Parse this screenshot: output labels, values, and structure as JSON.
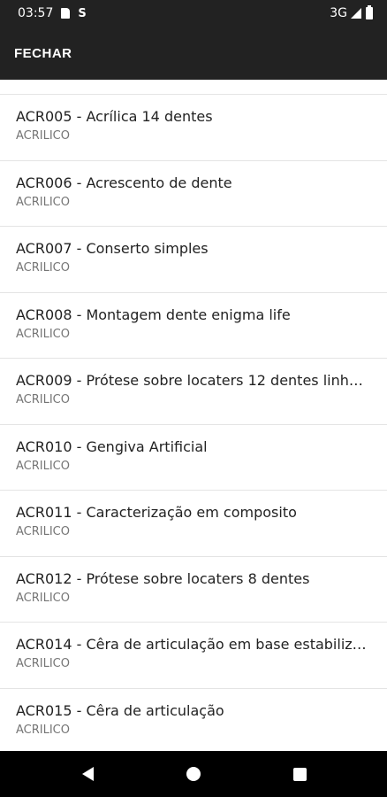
{
  "status_bar": {
    "time": "03:57",
    "network": "3G",
    "icons": [
      "sd-card-icon",
      "s-notification-icon",
      "signal-icon",
      "battery-icon"
    ],
    "s_glyph": "S"
  },
  "app_bar": {
    "close_label": "FECHAR",
    "background": "#222222"
  },
  "list": {
    "items": [
      {
        "title": "ACR005 - Acrílica 14 dentes",
        "subtitle": "ACRILICO"
      },
      {
        "title": "ACR006 - Acrescento de dente",
        "subtitle": "ACRILICO"
      },
      {
        "title": "ACR007 - Conserto simples",
        "subtitle": "ACRILICO"
      },
      {
        "title": "ACR008 - Montagem dente enigma life",
        "subtitle": "ACRILICO"
      },
      {
        "title": "ACR009 - Prótese sobre locaters 12 dentes linha ...",
        "subtitle": "ACRILICO"
      },
      {
        "title": "ACR010 - Gengiva Artificial",
        "subtitle": "ACRILICO"
      },
      {
        "title": "ACR011 - Caracterização em composito",
        "subtitle": "ACRILICO"
      },
      {
        "title": "ACR012 - Prótese sobre locaters 8 dentes",
        "subtitle": "ACRILICO"
      },
      {
        "title": "ACR014 - Cêra de articulação em base estabiliza...",
        "subtitle": "ACRILICO"
      },
      {
        "title": "ACR015 - Cêra de articulação",
        "subtitle": "ACRILICO"
      }
    ]
  },
  "nav_bar": {
    "buttons": [
      "back-icon",
      "home-icon",
      "recents-icon"
    ]
  }
}
